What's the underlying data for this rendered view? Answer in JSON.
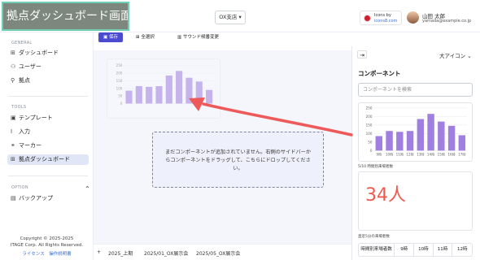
{
  "header": {
    "title": "拠点ダッシュボード画面",
    "store_select": "OX支店 ▾",
    "icons_by_line1": "Icons by",
    "icons_by_line2": "icons8.com",
    "user_name": "山田 太郎",
    "user_email": "yamada@example.co.jp"
  },
  "sidebar": {
    "section_general": "GENERAL",
    "general_items": [
      {
        "icon": "⊞",
        "label": "ダッシュボード"
      },
      {
        "icon": "⚇",
        "label": "ユーザー"
      },
      {
        "icon": "⚲",
        "label": "拠点"
      }
    ],
    "section_tools": "TOOLS",
    "tools_items": [
      {
        "icon": "▣",
        "label": "テンプレート"
      },
      {
        "icon": "I",
        "label": "入力"
      },
      {
        "icon": "⚭",
        "label": "マーカー"
      },
      {
        "icon": "⊞",
        "label": "拠点ダッシュボード"
      }
    ],
    "section_option": "OPTION",
    "option_items": [
      {
        "icon": "▤",
        "label": "バックアップ"
      }
    ],
    "copyright_line1": "Copyright © 2025-2025",
    "copyright_line2": "ITAGE Corp. All Rights Reserved.",
    "link_license": "ライセンス",
    "link_manual": "操作説明書"
  },
  "toolbar": {
    "save_label": "保存",
    "select_all_label": "全選択",
    "sound_label": "サウンド候番変更"
  },
  "canvas": {
    "drop_message": "まだコンポーネントが追加されていません。右側のサイドバーからコンポーネントをドラッグして、こちらにドロップしてください。"
  },
  "tabs": {
    "add": "+",
    "items": [
      "2025_上期",
      "2025/01_OX展示会",
      "2025/05_OX展示会"
    ]
  },
  "panel": {
    "size_select": "大アイコン ⌄",
    "title": "コンポーネント",
    "search_placeholder": "コンポーネントを検索",
    "chart_caption": "5/10 時間別来場者数",
    "big_number": "34人",
    "number_caption": "直近5分の来場者数",
    "table_headers": [
      "時間別来場者数",
      "9時",
      "10時",
      "11時",
      "12時"
    ]
  },
  "colors": {
    "accent": "#4b4bd2",
    "bar": "#9f7fe0",
    "arrow": "#ee5a5a",
    "big_number": "#ee5a4f"
  },
  "chart_data": {
    "type": "bar",
    "categories": [
      "9時",
      "10時",
      "11時",
      "12時",
      "13時",
      "14時",
      "15時",
      "16時",
      "17時"
    ],
    "values": [
      85,
      115,
      110,
      115,
      185,
      215,
      170,
      145,
      90
    ],
    "ylim": [
      0,
      250
    ],
    "yticks": [
      0,
      50,
      100,
      150,
      200,
      250
    ],
    "xlabel": "",
    "ylabel": ""
  }
}
